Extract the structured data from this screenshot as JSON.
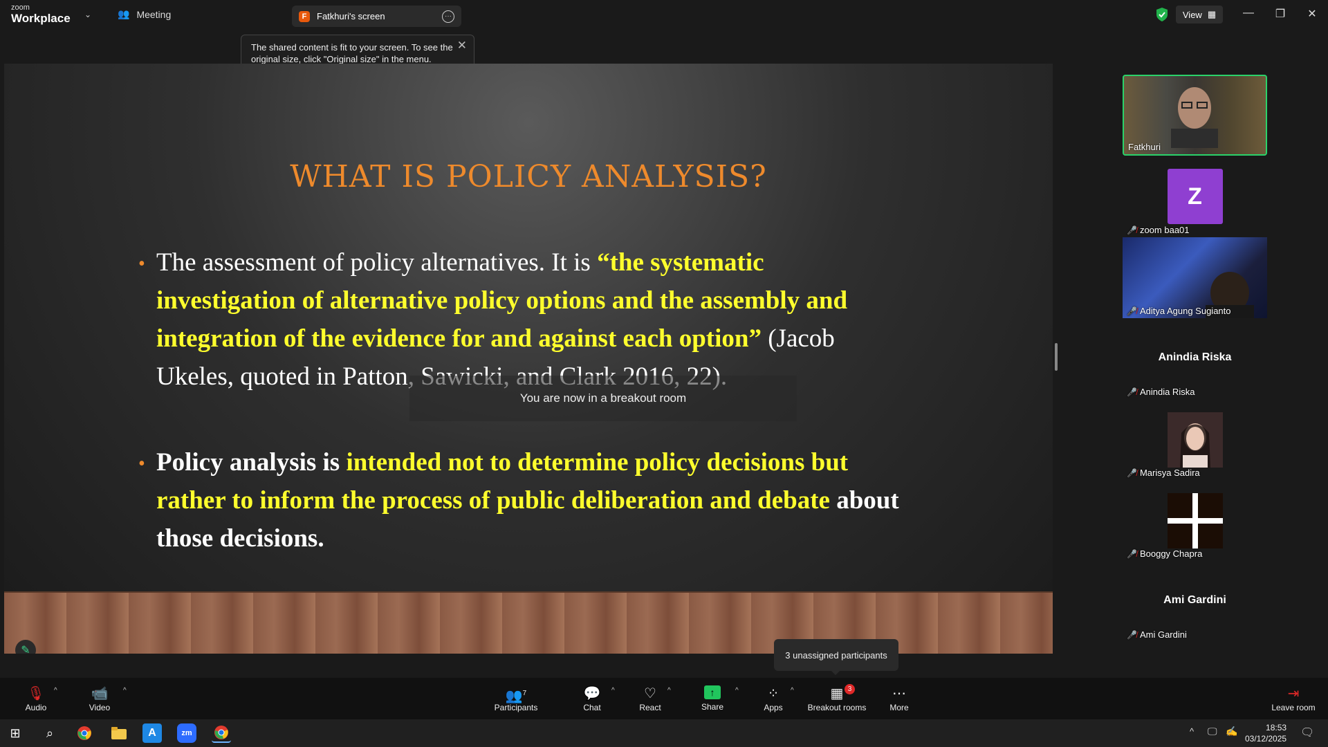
{
  "app": {
    "logo_top": "zoom",
    "logo_bottom": "Workplace"
  },
  "tabs": {
    "meeting": "Meeting",
    "screen_badge": "F",
    "screen": "Fatkhuri's screen"
  },
  "header": {
    "view": "View"
  },
  "tooltip": {
    "text": "The shared content is fit to your screen. To see the original size, click \"Original size\" in the menu."
  },
  "slide": {
    "title": "WHAT IS POLICY ANALYSIS?",
    "b1_plain": "The assessment of policy alternatives. It is ",
    "b1_quote": "“the systematic investigation of alternative policy options and the assembly and integration of the evidence for and against each option”",
    "b1_cite": " (Jacob Ukeles, quoted in Patton, Sawicki, and Clark 2016, 22).",
    "b2_bold": "Policy analysis is ",
    "b2_yellow": "intended not to determine policy decisions but rather to inform the process of public deliberation and debate",
    "b2_end": " about those decisions."
  },
  "breakout_message": "You are now in a breakout room",
  "participants": [
    {
      "name": "Fatkhuri"
    },
    {
      "name": "zoom baa01",
      "initial": "Z"
    },
    {
      "name": "Aditya Agung Sugianto"
    },
    {
      "name": "Anindia Riska",
      "label": "Anindia Riska"
    },
    {
      "name": "Marisya Sadira"
    },
    {
      "name": "Booggy Chapra"
    },
    {
      "name": "Ami Gardini",
      "label": "Ami Gardini"
    }
  ],
  "unassigned": "3 unassigned participants",
  "toolbar": {
    "audio": "Audio",
    "video": "Video",
    "participants": "Participants",
    "participants_count": "7",
    "chat": "Chat",
    "react": "React",
    "share": "Share",
    "apps": "Apps",
    "breakout": "Breakout rooms",
    "breakout_badge": "3",
    "more": "More",
    "leave": "Leave room"
  },
  "taskbar": {
    "time": "18:53",
    "date": "03/12/2025"
  },
  "colors": {
    "title": "#ee8a2c",
    "highlight": "#ffff2d",
    "speaker_border": "#2ad36a"
  }
}
